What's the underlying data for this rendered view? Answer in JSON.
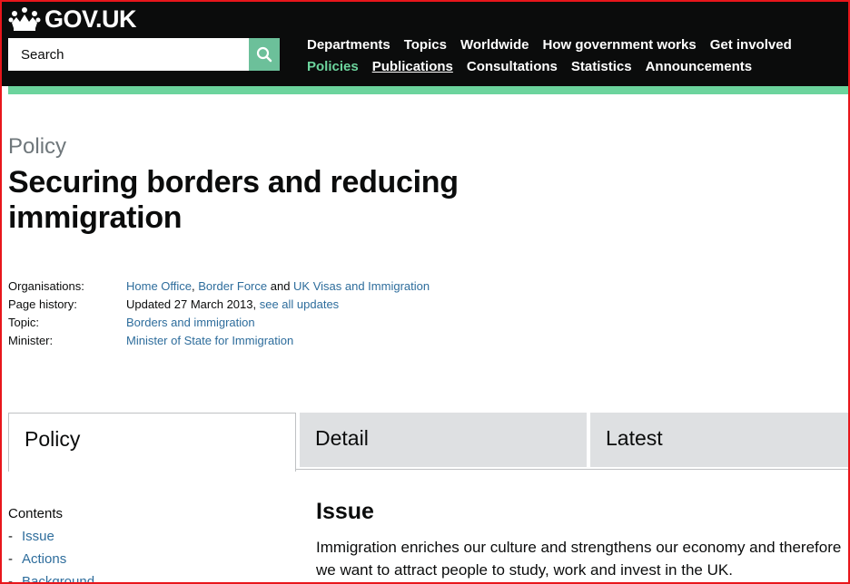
{
  "header": {
    "logo_text": "GOV.UK",
    "search_placeholder": "Search",
    "nav_row1": [
      "Departments",
      "Topics",
      "Worldwide",
      "How government works",
      "Get involved"
    ],
    "nav_row2": [
      "Policies",
      "Publications",
      "Consultations",
      "Statistics",
      "Announcements"
    ],
    "active_nav": "Policies",
    "current_nav": "Publications"
  },
  "page": {
    "kicker": "Policy",
    "title": "Securing borders and reducing immigration"
  },
  "meta": {
    "organisations_label": "Organisations:",
    "org1": "Home Office",
    "sep1": ", ",
    "org2": "Border Force",
    "and": " and ",
    "org3": "UK Visas and Immigration",
    "history_label": "Page history:",
    "history_text": "Updated 27 March 2013, ",
    "history_link": "see all updates",
    "topic_label": "Topic:",
    "topic": "Borders and immigration",
    "minister_label": "Minister:",
    "minister": "Minister of State for Immigration"
  },
  "tabs": [
    "Policy",
    "Detail",
    "Latest"
  ],
  "contents": {
    "heading": "Contents",
    "items": [
      "Issue",
      "Actions",
      "Background"
    ]
  },
  "section": {
    "heading": "Issue",
    "text": "Immigration enriches our culture and strengthens our economy and therefore we want to attract people to study, work and invest in the UK."
  },
  "colors": {
    "header_bg": "#0b0c0c",
    "accent_green": "#6cd49d",
    "link_blue": "#2e6d9c"
  }
}
